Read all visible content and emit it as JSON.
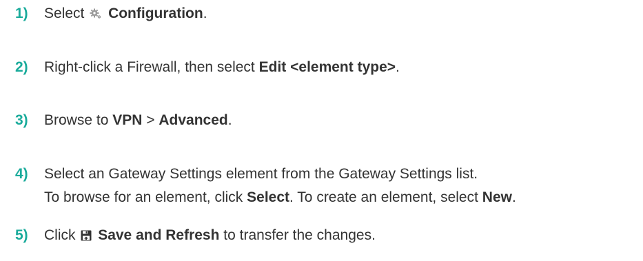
{
  "accent_color": "#1aab9b",
  "text_color": "#333333",
  "steps": [
    {
      "number": "1)",
      "pre": "Select",
      "icon": "gear-icon",
      "bold": "Configuration",
      "post": "."
    },
    {
      "number": "2)",
      "pre": "Right-click a Firewall, then select",
      "bold": "Edit <element type>",
      "post": "."
    },
    {
      "number": "3)",
      "pre": "Browse to",
      "bold1": "VPN",
      "sep": ">",
      "bold2": "Advanced",
      "post": "."
    },
    {
      "number": "4)",
      "line1": "Select an Gateway Settings element from the Gateway Settings list.",
      "line2_pre": "To browse for an element, click",
      "line2_bold1": "Select",
      "line2_mid": ". To create an element, select",
      "line2_bold2": "New",
      "line2_post": "."
    },
    {
      "number": "5)",
      "pre": "Click",
      "icon": "save-icon",
      "bold": "Save and Refresh",
      "post": "to transfer the changes."
    }
  ]
}
